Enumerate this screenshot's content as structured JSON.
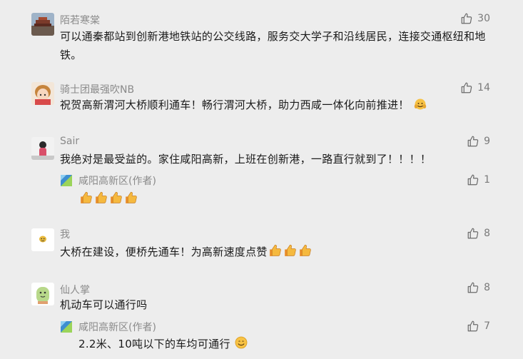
{
  "comments": [
    {
      "name": "陌若寒棠",
      "text": "可以通秦都站到创新港地铁站的公交线路，服务交大学子和沿线居民，连接交通枢纽和地铁。",
      "likes": "30"
    },
    {
      "name": "骑士团最强吹NB",
      "text": "祝贺高新渭河大桥顺利通车！畅行渭河大桥，助力西咸一体化向前推进！",
      "likes": "14"
    },
    {
      "name": "Sair",
      "text": "我绝对是最受益的。家住咸阳高新，上班在创新港，一路直行就到了！！！！",
      "likes": "9",
      "reply": {
        "name": "咸阳高新区(作者)",
        "likes": "1"
      }
    },
    {
      "name": "我",
      "text": "大桥在建设，便桥先通车！为高新速度点赞",
      "likes": "8"
    },
    {
      "name": "仙人掌",
      "text": "机动车可以通行吗",
      "likes": "8",
      "reply": {
        "name": "咸阳高新区(作者)",
        "text": "2.2米、10吨以下的车均可通行",
        "likes": "7"
      }
    }
  ],
  "icons": {
    "like": "thumb-up-outline-icon",
    "emoji_thumb": "thumbs-up-emoji",
    "emoji_cheer": "cheering-emoji",
    "emoji_smile": "smile-emoji",
    "author_badge": "author-badge-icon"
  },
  "colors": {
    "background": "#ededed",
    "name": "#8a8a8a",
    "text": "#1a1a1a"
  }
}
